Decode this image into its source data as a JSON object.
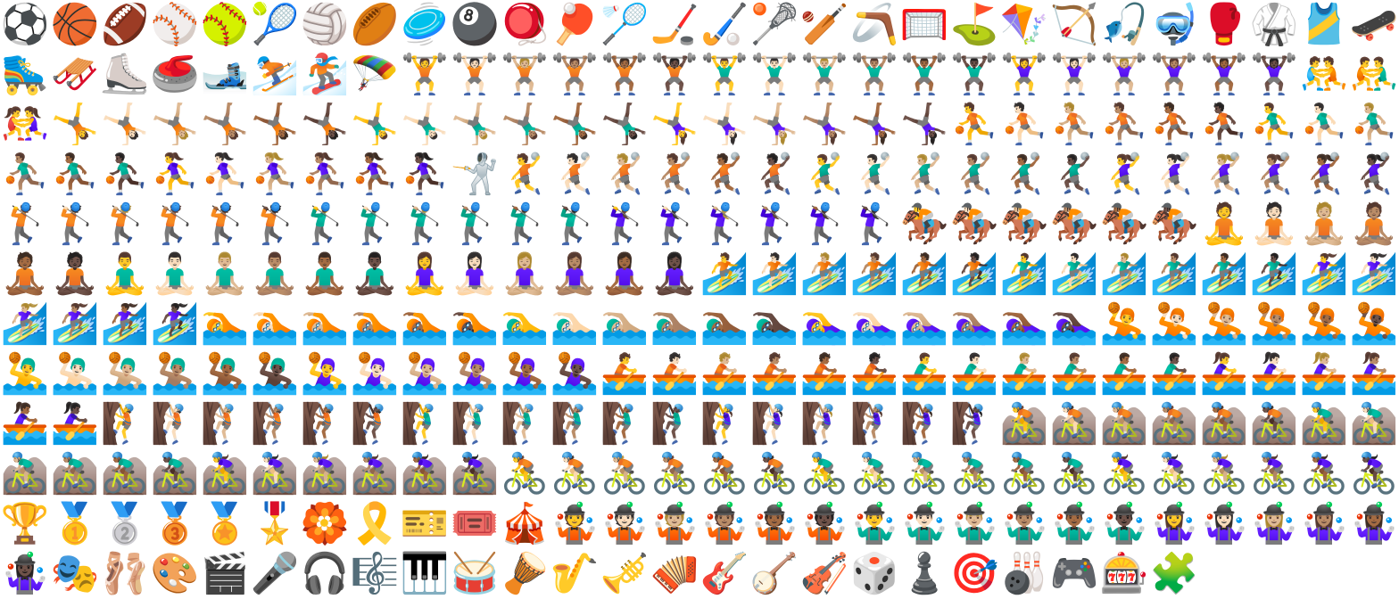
{
  "sheet": {
    "rows": [
      [
        "⚽",
        "🏀",
        "🏈",
        "⚾",
        "🥎",
        "🎾",
        "🏐",
        "🏉",
        "🥏",
        "🎱",
        "🪀",
        "🏓",
        "🏸",
        "🏒",
        "🏑",
        "🥍",
        "🏏",
        "🪃",
        "🥅",
        "⛳",
        "🪁",
        "🏹",
        "🎣",
        "🤿",
        "🥊",
        "🥋",
        "🎽",
        "🛹"
      ],
      [
        "🛼",
        "🛷",
        "⛸️",
        "🥌",
        "🎿",
        "⛷️",
        "🏂",
        "🪂",
        "🏋️",
        "🏋🏻",
        "🏋🏼",
        "🏋🏽",
        "🏋🏾",
        "🏋🏿",
        "🏋️‍♂️",
        "🏋🏻‍♂️",
        "🏋🏼‍♂️",
        "🏋🏽‍♂️",
        "🏋🏾‍♂️",
        "🏋🏿‍♂️",
        "🏋️‍♀️",
        "🏋🏻‍♀️",
        "🏋🏼‍♀️",
        "🏋🏽‍♀️",
        "🏋🏾‍♀️",
        "🏋🏿‍♀️",
        "🤼",
        "🤼‍♂️"
      ],
      [
        "🤼‍♀️",
        "🤸",
        "🤸🏻",
        "🤸🏼",
        "🤸🏽",
        "🤸🏾",
        "🤸🏿",
        "🤸‍♂️",
        "🤸🏻‍♂️",
        "🤸🏼‍♂️",
        "🤸🏽‍♂️",
        "🤸🏾‍♂️",
        "🤸🏿‍♂️",
        "🤸‍♀️",
        "🤸🏻‍♀️",
        "🤸🏼‍♀️",
        "🤸🏽‍♀️",
        "🤸🏾‍♀️",
        "🤸🏿‍♀️",
        "⛹️",
        "⛹🏻",
        "⛹🏼",
        "⛹🏽",
        "⛹🏾",
        "⛹🏿",
        "⛹️‍♂️",
        "⛹🏻‍♂️",
        "⛹🏼‍♂️"
      ],
      [
        "⛹🏽‍♂️",
        "⛹🏾‍♂️",
        "⛹🏿‍♂️",
        "⛹️‍♀️",
        "⛹🏻‍♀️",
        "⛹🏼‍♀️",
        "⛹🏽‍♀️",
        "⛹🏾‍♀️",
        "⛹🏿‍♀️",
        "🤺",
        "🤾",
        "🤾🏻",
        "🤾🏼",
        "🤾🏽",
        "🤾🏾",
        "🤾🏿",
        "🤾‍♂️",
        "🤾🏻‍♂️",
        "🤾🏼‍♂️",
        "🤾🏽‍♂️",
        "🤾🏾‍♂️",
        "🤾🏿‍♂️",
        "🤾‍♀️",
        "🤾🏻‍♀️",
        "🤾🏼‍♀️",
        "🤾🏽‍♀️",
        "🤾🏾‍♀️",
        "🤾🏿‍♀️"
      ],
      [
        "🏌️",
        "🏌🏻",
        "🏌🏼",
        "🏌🏽",
        "🏌🏾",
        "🏌🏿",
        "🏌️‍♂️",
        "🏌🏻‍♂️",
        "🏌🏼‍♂️",
        "🏌🏽‍♂️",
        "🏌🏾‍♂️",
        "🏌🏿‍♂️",
        "🏌️‍♀️",
        "🏌🏻‍♀️",
        "🏌🏼‍♀️",
        "🏌🏽‍♀️",
        "🏌🏾‍♀️",
        "🏌🏿‍♀️",
        "🏇",
        "🏇🏻",
        "🏇🏼",
        "🏇🏽",
        "🏇🏾",
        "🏇🏿",
        "🧘",
        "🧘🏻",
        "🧘🏼",
        "🧘🏽"
      ],
      [
        "🧘🏾",
        "🧘🏿",
        "🧘‍♂️",
        "🧘🏻‍♂️",
        "🧘🏼‍♂️",
        "🧘🏽‍♂️",
        "🧘🏾‍♂️",
        "🧘🏿‍♂️",
        "🧘‍♀️",
        "🧘🏻‍♀️",
        "🧘🏼‍♀️",
        "🧘🏽‍♀️",
        "🧘🏾‍♀️",
        "🧘🏿‍♀️",
        "🏄",
        "🏄🏻",
        "🏄🏼",
        "🏄🏽",
        "🏄🏾",
        "🏄🏿",
        "🏄‍♂️",
        "🏄🏻‍♂️",
        "🏄🏼‍♂️",
        "🏄🏽‍♂️",
        "🏄🏾‍♂️",
        "🏄🏿‍♂️",
        "🏄‍♀️",
        "🏄🏻‍♀️"
      ],
      [
        "🏄🏼‍♀️",
        "🏄🏽‍♀️",
        "🏄🏾‍♀️",
        "🏄🏿‍♀️",
        "🏊",
        "🏊🏻",
        "🏊🏼",
        "🏊🏽",
        "🏊🏾",
        "🏊🏿",
        "🏊‍♂️",
        "🏊🏻‍♂️",
        "🏊🏼‍♂️",
        "🏊🏽‍♂️",
        "🏊🏾‍♂️",
        "🏊🏿‍♂️",
        "🏊‍♀️",
        "🏊🏻‍♀️",
        "🏊🏼‍♀️",
        "🏊🏽‍♀️",
        "🏊🏾‍♀️",
        "🏊🏿‍♀️",
        "🤽",
        "🤽🏻",
        "🤽🏼",
        "🤽🏽",
        "🤽🏾",
        "🤽🏿"
      ],
      [
        "🤽‍♂️",
        "🤽🏻‍♂️",
        "🤽🏼‍♂️",
        "🤽🏽‍♂️",
        "🤽🏾‍♂️",
        "🤽🏿‍♂️",
        "🤽‍♀️",
        "🤽🏻‍♀️",
        "🤽🏼‍♀️",
        "🤽🏽‍♀️",
        "🤽🏾‍♀️",
        "🤽🏿‍♀️",
        "🚣",
        "🚣🏻",
        "🚣🏼",
        "🚣🏽",
        "🚣🏾",
        "🚣🏿",
        "🚣‍♂️",
        "🚣🏻‍♂️",
        "🚣🏼‍♂️",
        "🚣🏽‍♂️",
        "🚣🏾‍♂️",
        "🚣🏿‍♂️",
        "🚣‍♀️",
        "🚣🏻‍♀️",
        "🚣🏼‍♀️",
        "🚣🏽‍♀️"
      ],
      [
        "🚣🏾‍♀️",
        "🚣🏿‍♀️",
        "🧗",
        "🧗🏻",
        "🧗🏼",
        "🧗🏽",
        "🧗🏾",
        "🧗🏿",
        "🧗‍♂️",
        "🧗🏻‍♂️",
        "🧗🏼‍♂️",
        "🧗🏽‍♂️",
        "🧗🏾‍♂️",
        "🧗🏿‍♂️",
        "🧗‍♀️",
        "🧗🏻‍♀️",
        "🧗🏼‍♀️",
        "🧗🏽‍♀️",
        "🧗🏾‍♀️",
        "🧗🏿‍♀️",
        "🚵",
        "🚵🏻",
        "🚵🏼",
        "🚵🏽",
        "🚵🏾",
        "🚵🏿",
        "🚵‍♂️",
        "🚵🏻‍♂️"
      ],
      [
        "🚵🏼‍♂️",
        "🚵🏽‍♂️",
        "🚵🏾‍♂️",
        "🚵🏿‍♂️",
        "🚵‍♀️",
        "🚵🏻‍♀️",
        "🚵🏼‍♀️",
        "🚵🏽‍♀️",
        "🚵🏾‍♀️",
        "🚵🏿‍♀️",
        "🚴",
        "🚴🏻",
        "🚴🏼",
        "🚴🏽",
        "🚴🏾",
        "🚴🏿",
        "🚴‍♂️",
        "🚴🏻‍♂️",
        "🚴🏼‍♂️",
        "🚴🏽‍♂️",
        "🚴🏾‍♂️",
        "🚴🏿‍♂️",
        "🚴‍♀️",
        "🚴🏻‍♀️",
        "🚴🏼‍♀️",
        "🚴🏽‍♀️",
        "🚴🏾‍♀️",
        "🚴🏿‍♀️"
      ],
      [
        "🏆",
        "🥇",
        "🥈",
        "🥉",
        "🏅",
        "🎖️",
        "🏵️",
        "🎗️",
        "🎫",
        "🎟️",
        "🎪",
        "🤹",
        "🤹🏻",
        "🤹🏼",
        "🤹🏽",
        "🤹🏾",
        "🤹🏿",
        "🤹‍♂️",
        "🤹🏻‍♂️",
        "🤹🏼‍♂️",
        "🤹🏽‍♂️",
        "🤹🏾‍♂️",
        "🤹🏿‍♂️",
        "🤹‍♀️",
        "🤹🏻‍♀️",
        "🤹🏼‍♀️",
        "🤹🏽‍♀️",
        "🤹🏾‍♀️"
      ],
      [
        "🤹🏿‍♀️",
        "🎭",
        "🩰",
        "🎨",
        "🎬",
        "🎤",
        "🎧",
        "🎼",
        "🎹",
        "🥁",
        "🪘",
        "🎷",
        "🎺",
        "🪗",
        "🎸",
        "🪕",
        "🎻",
        "🎲",
        "♟️",
        "🎯",
        "🎳",
        "🎮",
        "🎰",
        "🧩"
      ]
    ]
  }
}
